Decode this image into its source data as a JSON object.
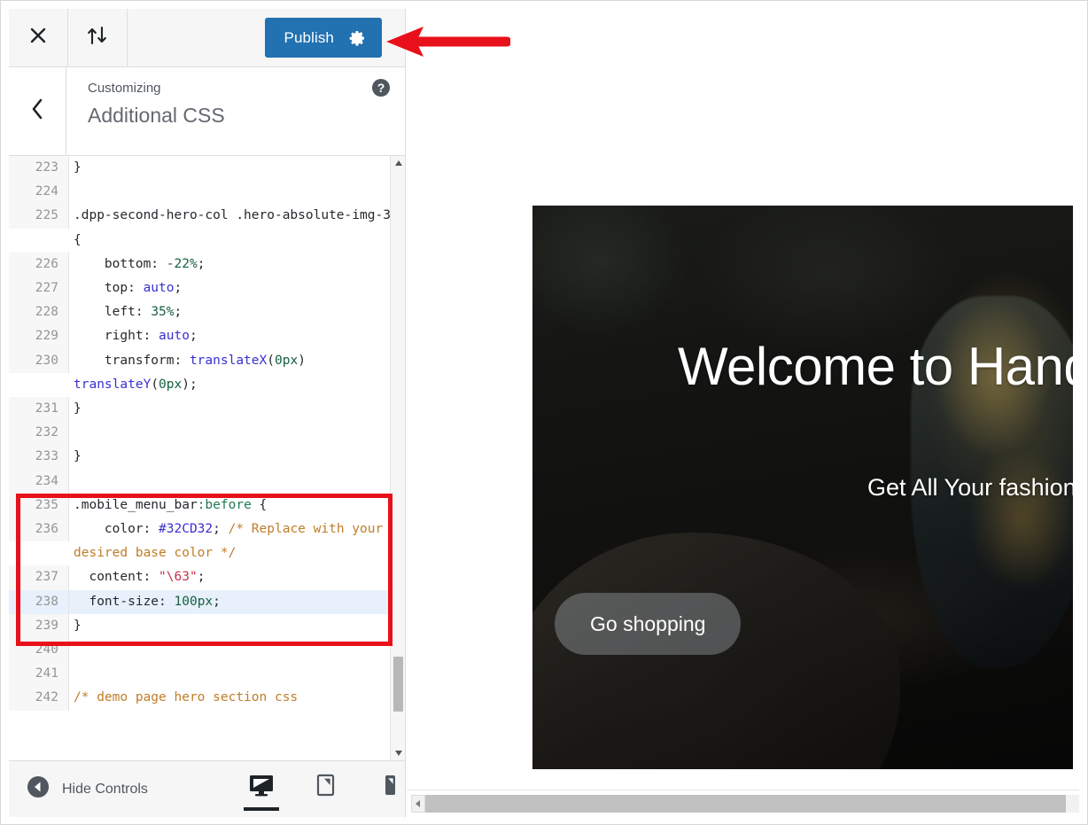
{
  "topbar": {
    "close_icon": "close-icon",
    "save_status_icon": "up-down-arrows-icon",
    "publish_label": "Publish",
    "publish_gear_icon": "gear-icon",
    "publish_color": "#2271b1"
  },
  "panel_header": {
    "back_icon": "chevron-left-icon",
    "subtitle": "Customizing",
    "title": "Additional CSS",
    "help_icon": "help-circle-icon"
  },
  "editor": {
    "active_line": 238,
    "highlight_box_color": "#e8101a",
    "lines": [
      {
        "num": "223",
        "tokens": [
          {
            "t": "}",
            "c": "t-punct"
          }
        ]
      },
      {
        "num": "224",
        "tokens": []
      },
      {
        "num": "225",
        "tokens": [
          {
            "t": ".dpp-second-hero-col .hero-absolute-img-3 {",
            "c": "t-sel"
          }
        ]
      },
      {
        "num": "226",
        "tokens": [
          {
            "t": "    bottom: ",
            "c": "t-prop"
          },
          {
            "t": "-22%",
            "c": "t-num"
          },
          {
            "t": ";",
            "c": "t-punct"
          }
        ]
      },
      {
        "num": "227",
        "tokens": [
          {
            "t": "    top: ",
            "c": "t-prop"
          },
          {
            "t": "auto",
            "c": "t-kw"
          },
          {
            "t": ";",
            "c": "t-punct"
          }
        ]
      },
      {
        "num": "228",
        "tokens": [
          {
            "t": "    left: ",
            "c": "t-prop"
          },
          {
            "t": "35%",
            "c": "t-num"
          },
          {
            "t": ";",
            "c": "t-punct"
          }
        ]
      },
      {
        "num": "229",
        "tokens": [
          {
            "t": "    right: ",
            "c": "t-prop"
          },
          {
            "t": "auto",
            "c": "t-kw"
          },
          {
            "t": ";",
            "c": "t-punct"
          }
        ]
      },
      {
        "num": "230",
        "tokens": [
          {
            "t": "    transform: ",
            "c": "t-prop"
          },
          {
            "t": "translateX",
            "c": "t-fn"
          },
          {
            "t": "(",
            "c": "t-punct"
          },
          {
            "t": "0px",
            "c": "t-num"
          },
          {
            "t": ") ",
            "c": "t-punct"
          },
          {
            "t": "translateY",
            "c": "t-fn"
          },
          {
            "t": "(",
            "c": "t-punct"
          },
          {
            "t": "0px",
            "c": "t-num"
          },
          {
            "t": ");",
            "c": "t-punct"
          }
        ]
      },
      {
        "num": "231",
        "tokens": [
          {
            "t": "}",
            "c": "t-punct"
          }
        ]
      },
      {
        "num": "232",
        "tokens": []
      },
      {
        "num": "233",
        "tokens": [
          {
            "t": "}",
            "c": "t-punct"
          }
        ]
      },
      {
        "num": "234",
        "tokens": []
      },
      {
        "num": "235",
        "tokens": [
          {
            "t": ".mobile_menu_bar",
            "c": "t-sel"
          },
          {
            "t": ":before",
            "c": "t-pseudo"
          },
          {
            "t": " {",
            "c": "t-punct"
          }
        ]
      },
      {
        "num": "236",
        "tokens": [
          {
            "t": "    color: ",
            "c": "t-prop"
          },
          {
            "t": "#32CD32",
            "c": "t-hex"
          },
          {
            "t": "; ",
            "c": "t-punct"
          },
          {
            "t": "/* Replace with your desired base color */",
            "c": "t-com"
          }
        ]
      },
      {
        "num": "237",
        "tokens": [
          {
            "t": "  content: ",
            "c": "t-prop"
          },
          {
            "t": "\"\\63\"",
            "c": "t-str"
          },
          {
            "t": ";",
            "c": "t-punct"
          }
        ]
      },
      {
        "num": "238",
        "tokens": [
          {
            "t": "  font-size: ",
            "c": "t-prop"
          },
          {
            "t": "100px",
            "c": "t-num"
          },
          {
            "t": ";",
            "c": "t-punct"
          }
        ]
      },
      {
        "num": "239",
        "tokens": [
          {
            "t": "}",
            "c": "t-punct"
          }
        ]
      },
      {
        "num": "240",
        "tokens": []
      },
      {
        "num": "241",
        "tokens": []
      },
      {
        "num": "242",
        "tokens": [
          {
            "t": "/* demo page hero section css",
            "c": "t-com"
          }
        ]
      }
    ]
  },
  "footer": {
    "hide_controls_icon": "collapse-left-icon",
    "hide_controls_label": "Hide Controls",
    "devices": [
      {
        "name": "desktop",
        "icon": "desktop-icon",
        "active": true
      },
      {
        "name": "tablet",
        "icon": "tablet-icon",
        "active": false
      },
      {
        "name": "mobile",
        "icon": "mobile-icon",
        "active": false
      }
    ]
  },
  "preview": {
    "hero_title": "Welcome to Hand",
    "hero_subtitle": "Get All Your fashion St",
    "cta_label": "Go shopping",
    "scroll_left_icon": "scroll-left-arrow-icon"
  },
  "annotation": {
    "arrow_name": "red-pointer-arrow",
    "arrow_color": "#e8101a"
  }
}
